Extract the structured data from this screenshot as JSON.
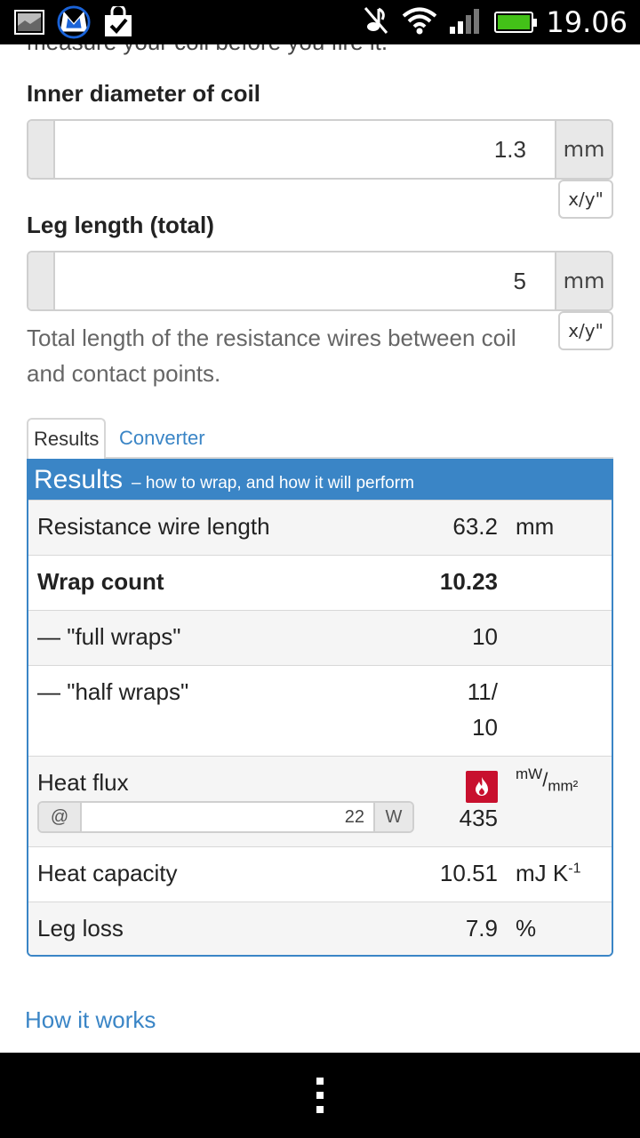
{
  "status_bar": {
    "time": "19.06",
    "icons": [
      "gallery-icon",
      "malwarebytes-icon",
      "shopping-bag-icon",
      "mute-icon",
      "wifi-icon",
      "signal-icon",
      "battery-icon"
    ]
  },
  "form": {
    "cut_text": "measure your coil before you fire it.",
    "inner_diameter": {
      "label": "Inner diameter of coil",
      "value": "1.3",
      "unit": "mm",
      "fraction_button": "x/y\""
    },
    "leg_length": {
      "label": "Leg length (total)",
      "value": "5",
      "unit": "mm",
      "fraction_button": "x/y\"",
      "help": "Total length of the resistance wires between coil and contact points."
    }
  },
  "tabs": [
    {
      "label": "Results",
      "active": true
    },
    {
      "label": "Converter",
      "active": false
    }
  ],
  "results": {
    "title": "Results",
    "subtitle": "– how to wrap, and how it will perform",
    "rows": {
      "wire_length": {
        "label": "Resistance wire length",
        "value": "63.2",
        "unit": "mm"
      },
      "wrap_count": {
        "label": "Wrap count",
        "value": "10.23"
      },
      "full_wraps": {
        "label": "— \"full wraps\"",
        "value": "10"
      },
      "half_wraps": {
        "label": "— \"half wraps\"",
        "value_line1": "11/",
        "value_line2": "10"
      },
      "heat_flux": {
        "label": "Heat flux",
        "value": "435",
        "unit_num": "mW",
        "unit_den": "mm²",
        "at_label": "@",
        "watts": "22",
        "watts_unit": "W"
      },
      "heat_capacity": {
        "label": "Heat capacity",
        "value": "10.51",
        "unit": "mJ K",
        "unit_exp": "-1"
      },
      "leg_loss": {
        "label": "Leg loss",
        "value": "7.9",
        "unit": "%"
      }
    }
  },
  "links": {
    "how_it_works": "How it works"
  },
  "colors": {
    "accent": "#3a85c6",
    "flame": "#c8102e",
    "battery": "#43c118"
  }
}
